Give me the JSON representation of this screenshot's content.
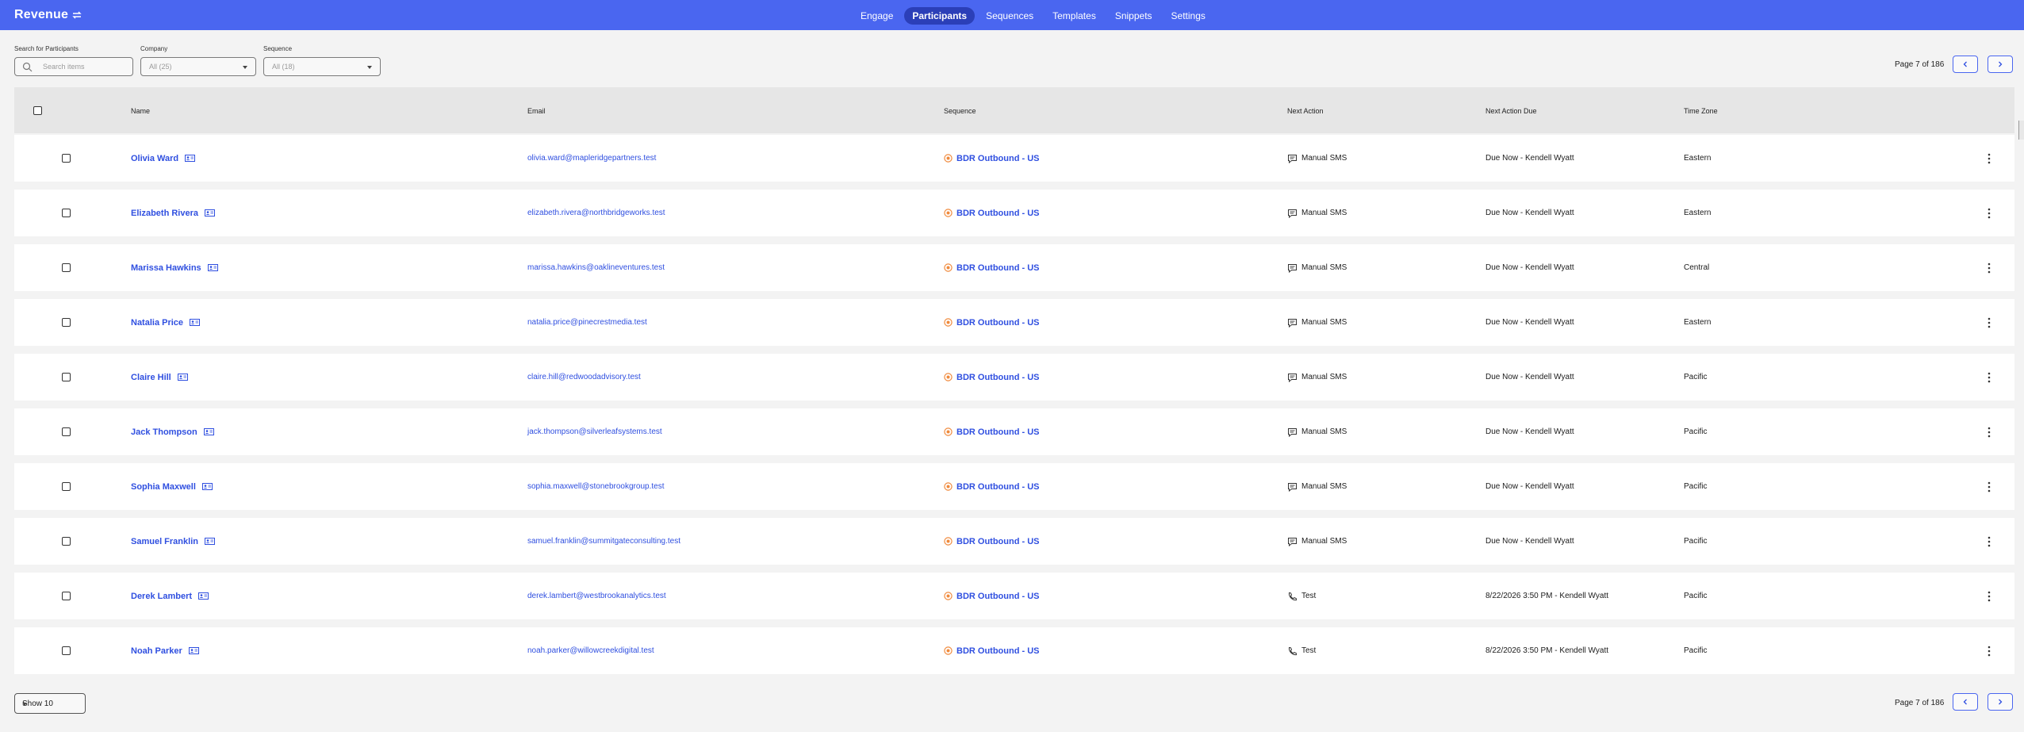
{
  "app": {
    "title": "Revenue"
  },
  "nav": [
    {
      "label": "Engage",
      "active": false
    },
    {
      "label": "Participants",
      "active": true
    },
    {
      "label": "Sequences",
      "active": false
    },
    {
      "label": "Templates",
      "active": false
    },
    {
      "label": "Snippets",
      "active": false
    },
    {
      "label": "Settings",
      "active": false
    }
  ],
  "filters": {
    "search": {
      "label": "Search for Participants",
      "placeholder": "Search items"
    },
    "company": {
      "label": "Company",
      "value": "All (25)"
    },
    "sequence": {
      "label": "Sequence",
      "value": "All (18)"
    }
  },
  "pager": {
    "text": "Page 7 of 186"
  },
  "columns": {
    "name": "Name",
    "email": "Email",
    "sequence": "Sequence",
    "next_action": "Next Action",
    "next_action_due": "Next Action Due",
    "time_zone": "Time Zone"
  },
  "rows": [
    {
      "name": "Olivia Ward",
      "email": "olivia.ward@mapleridgepartners.test",
      "sequence": "BDR Outbound - US",
      "action": "Manual SMS",
      "action_icon": "sms-icon",
      "due": "Due Now - Kendell Wyatt",
      "tz": "Eastern"
    },
    {
      "name": "Elizabeth Rivera",
      "email": "elizabeth.rivera@northbridgeworks.test",
      "sequence": "BDR Outbound - US",
      "action": "Manual SMS",
      "action_icon": "sms-icon",
      "due": "Due Now - Kendell Wyatt",
      "tz": "Eastern"
    },
    {
      "name": "Marissa Hawkins",
      "email": "marissa.hawkins@oaklineventures.test",
      "sequence": "BDR Outbound - US",
      "action": "Manual SMS",
      "action_icon": "sms-icon",
      "due": "Due Now - Kendell Wyatt",
      "tz": "Central"
    },
    {
      "name": "Natalia Price",
      "email": "natalia.price@pinecrestmedia.test",
      "sequence": "BDR Outbound - US",
      "action": "Manual SMS",
      "action_icon": "sms-icon",
      "due": "Due Now - Kendell Wyatt",
      "tz": "Eastern"
    },
    {
      "name": "Claire Hill",
      "email": "claire.hill@redwoodadvisory.test",
      "sequence": "BDR Outbound - US",
      "action": "Manual SMS",
      "action_icon": "sms-icon",
      "due": "Due Now - Kendell Wyatt",
      "tz": "Pacific"
    },
    {
      "name": "Jack Thompson",
      "email": "jack.thompson@silverleafsystems.test",
      "sequence": "BDR Outbound - US",
      "action": "Manual SMS",
      "action_icon": "sms-icon",
      "due": "Due Now - Kendell Wyatt",
      "tz": "Pacific"
    },
    {
      "name": "Sophia Maxwell",
      "email": "sophia.maxwell@stonebrookgroup.test",
      "sequence": "BDR Outbound - US",
      "action": "Manual SMS",
      "action_icon": "sms-icon",
      "due": "Due Now - Kendell Wyatt",
      "tz": "Pacific"
    },
    {
      "name": "Samuel Franklin",
      "email": "samuel.franklin@summitgateconsulting.test",
      "sequence": "BDR Outbound - US",
      "action": "Manual SMS",
      "action_icon": "sms-icon",
      "due": "Due Now - Kendell Wyatt",
      "tz": "Pacific"
    },
    {
      "name": "Derek Lambert",
      "email": "derek.lambert@westbrookanalytics.test",
      "sequence": "BDR Outbound - US",
      "action": "Test",
      "action_icon": "phone-icon",
      "due": "8/22/2026 3:50 PM - Kendell Wyatt",
      "tz": "Pacific"
    },
    {
      "name": "Noah Parker",
      "email": "noah.parker@willowcreekdigital.test",
      "sequence": "BDR Outbound - US",
      "action": "Test",
      "action_icon": "phone-icon",
      "due": "8/22/2026 3:50 PM - Kendell Wyatt",
      "tz": "Pacific"
    }
  ],
  "footer": {
    "show_label": "Show 10"
  },
  "colors": {
    "brand": "#4a66f0",
    "link": "#2f4fe0",
    "sequence_icon": "#f08a3c"
  }
}
